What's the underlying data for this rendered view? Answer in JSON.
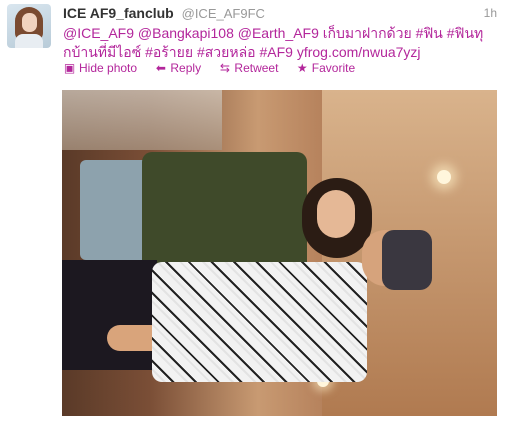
{
  "tweet": {
    "fullname": "ICE AF9_fanclub",
    "username": "@ICE_AF9FC",
    "time": "1h",
    "text_line1": "@ICE_AF9 @Bangkapi108 @Earth_AF9 เก็บมาฝากด้วย #ฟิน #ฟินทุ",
    "text_line2": "กบ้านที่มีไอซ์ #อร้ายย #สวยหล่อ #AF9 yfrog.com/nwua7yzj"
  },
  "actions": {
    "hide_photo": "Hide photo",
    "reply": "Reply",
    "retweet": "Retweet",
    "favorite": "Favorite"
  },
  "icons": {
    "hide_photo": "photo-icon",
    "reply": "reply-arrow-icon",
    "retweet": "retweet-icon",
    "favorite": "star-icon"
  },
  "colors": {
    "link": "#b3269b",
    "text": "#333333",
    "muted": "#999999"
  }
}
